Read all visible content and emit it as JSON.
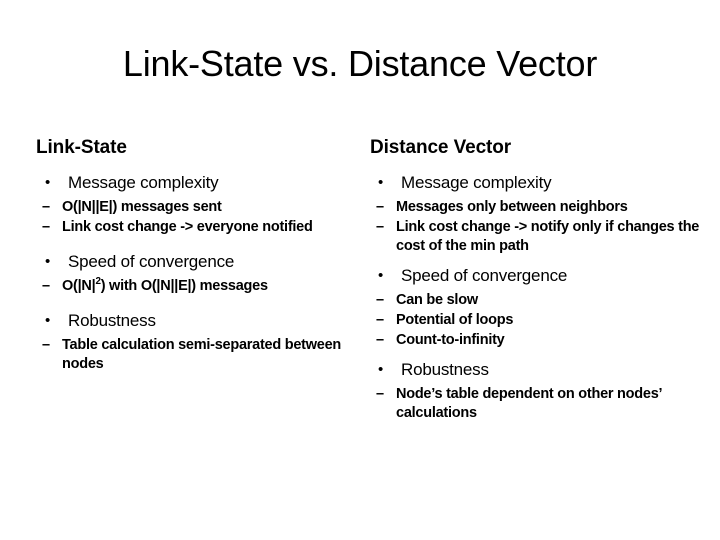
{
  "slide": {
    "title": "Link-State vs. Distance Vector",
    "background_color": "#ffffff",
    "text_color": "#000000",
    "bullet_marker": "•",
    "sub_bullet_marker": "–"
  },
  "columns": [
    {
      "heading": "Link-State",
      "groups": [
        {
          "label": "Message complexity",
          "items": [
            "O(|N||E|) messages sent",
            "Link cost change -> everyone notified"
          ]
        },
        {
          "label": "Speed of convergence",
          "items": [
            "O(|N|2) with O(|N||E|) messages"
          ]
        },
        {
          "label": "Robustness",
          "items": [
            "Table calculation semi-separated between nodes"
          ]
        }
      ]
    },
    {
      "heading": "Distance Vector",
      "groups": [
        {
          "label": "Message complexity",
          "items": [
            "Messages only between neighbors",
            "Link cost change -> notify only if changes the cost of the min path"
          ]
        },
        {
          "label": "Speed of convergence",
          "items": [
            "Can be slow",
            "Potential of loops",
            "Count-to-infinity"
          ]
        },
        {
          "label": "Robustness",
          "items": [
            "Node’s table dependent on other nodes’ calculations"
          ]
        }
      ]
    }
  ],
  "left": {
    "heading": "Link-State",
    "g0_label": "Message complexity",
    "g0_i0": "O(|N||E|) messages sent",
    "g0_i1": "Link cost change -> everyone notified",
    "g1_label": "Speed of convergence",
    "g1_i0_pre": "O(|N|",
    "g1_i0_sup": "2",
    "g1_i0_post": ") with O(|N||E|) messages",
    "g2_label": "Robustness",
    "g2_i0": "Table calculation semi-separated between nodes"
  },
  "right": {
    "heading": "Distance Vector",
    "g0_label": "Message complexity",
    "g0_i0": "Messages only between neighbors",
    "g0_i1": "Link cost change -> notify only if changes the cost of the min path",
    "g1_label": "Speed of convergence",
    "g1_i0": "Can be slow",
    "g1_i1": "Potential of loops",
    "g1_i2": "Count-to-infinity",
    "g2_label": "Robustness",
    "g2_i0": "Node’s table dependent on other nodes’ calculations"
  }
}
